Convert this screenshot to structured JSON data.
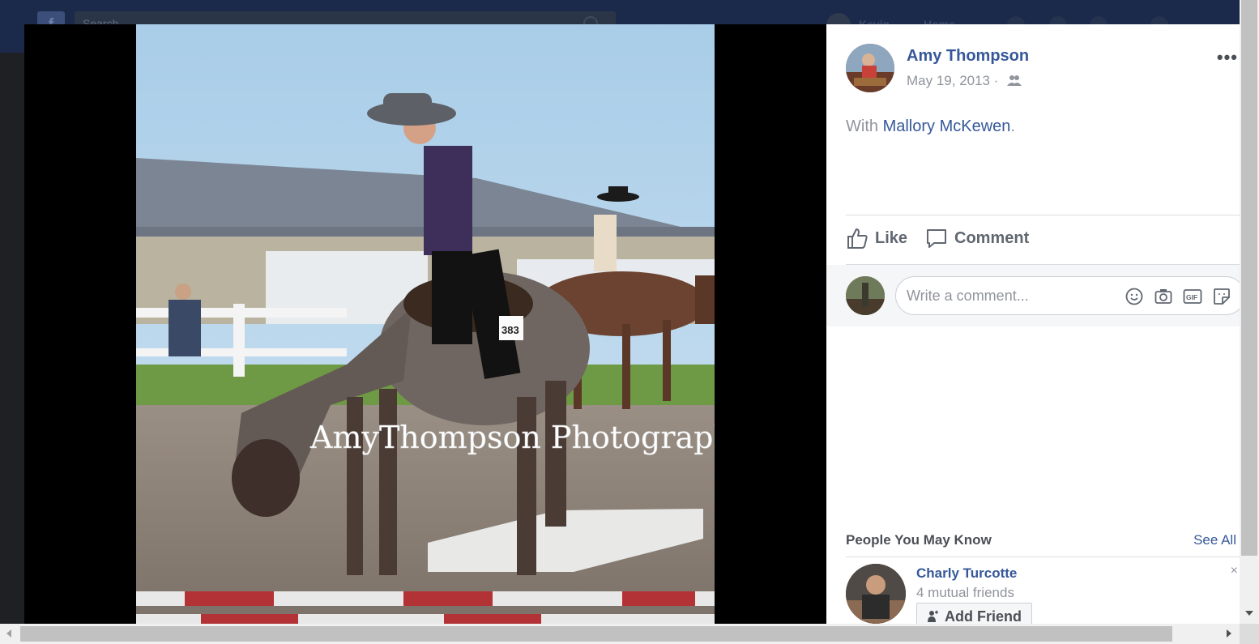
{
  "topbar": {
    "logo": "f",
    "search_placeholder": "Search",
    "user_name": "Kevin",
    "home_label": "Home"
  },
  "photo": {
    "watermark": "AmyThompson Photography",
    "bib_number": "383"
  },
  "post": {
    "author": "Amy Thompson",
    "date": "May 19, 2013 ·",
    "with_prefix": "With",
    "with_person": "Mallory McKewen",
    "with_suffix": ".",
    "more_label": "•••"
  },
  "actions": {
    "like_label": "Like",
    "comment_label": "Comment"
  },
  "comment_box": {
    "placeholder": "Write a comment...",
    "gif_label": "GIF"
  },
  "pymk": {
    "title": "People You May Know",
    "see_all": "See All",
    "people": [
      {
        "name": "Charly Turcotte",
        "mutual": "4 mutual friends",
        "button": "Add Friend"
      }
    ],
    "close_label": "×"
  },
  "colors": {
    "link": "#365899",
    "meta": "#90949c",
    "topbar": "#1b2a4a"
  }
}
